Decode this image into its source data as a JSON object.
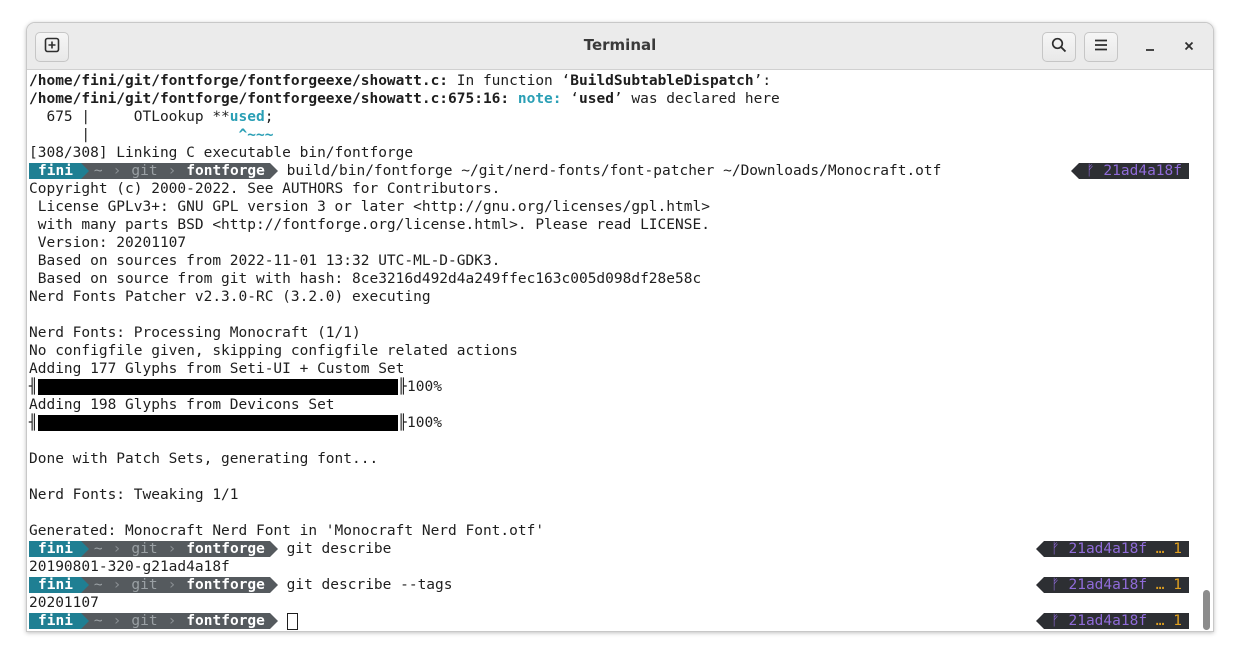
{
  "window": {
    "title": "Terminal"
  },
  "headerbar": {
    "new_tab_icon": "new-tab-icon",
    "search_icon": "search-icon",
    "menu_icon": "hamburger-menu-icon",
    "minimize_glyph": "–",
    "close_glyph": "✕"
  },
  "prompt": {
    "user": "fini",
    "home": "~",
    "dir1": "git",
    "dir2": "fontforge"
  },
  "output": {
    "l1_path": "/home/fini/git/fontforge/fontforgeexe/showatt.c:",
    "l1_text": " In function ",
    "l1_quote_open": "‘",
    "l1_func": "BuildSubtableDispatch",
    "l1_quote_close": "’:",
    "l2_path": "/home/fini/git/fontforge/fontforgeexe/showatt.c:675:16:",
    "l2_note": " note:",
    "l2_text_a": " ‘",
    "l2_used": "used",
    "l2_text_b": "’ was declared here",
    "l3_prefix": "  675 |     OTLookup **",
    "l3_used": "used",
    "l3_suffix": ";",
    "l4_prefix": "      |",
    "l4_caret": "                 ^~~~",
    "l5": "[308/308] Linking C executable bin/fontforge",
    "cmd1": " build/bin/fontforge ~/git/nerd-fonts/font-patcher ~/Downloads/Monocraft.otf",
    "l7": "Copyright (c) 2000-2022. See AUTHORS for Contributors.",
    "l8": " License GPLv3+: GNU GPL version 3 or later <http://gnu.org/licenses/gpl.html>",
    "l9": " with many parts BSD <http://fontforge.org/license.html>. Please read LICENSE.",
    "l10": " Version: 20201107",
    "l11": " Based on sources from 2022-11-01 13:32 UTC-ML-D-GDK3.",
    "l12": " Based on source from git with hash: 8ce3216d492d4a249ffec163c005d098df28e58c",
    "l13": "Nerd Fonts Patcher v2.3.0-RC (3.2.0) executing",
    "l15": "Nerd Fonts: Processing Monocraft (1/1)",
    "l16": "No configfile given, skipping configfile related actions",
    "l17": "Adding 177 Glyphs from Seti-UI + Custom Set",
    "bar1_pct": "100%",
    "bar1_progress": 1.0,
    "l19": "Adding 198 Glyphs from Devicons Set",
    "bar2_pct": "100%",
    "bar2_progress": 1.0,
    "l22": "Done with Patch Sets, generating font...",
    "l24": "Nerd Fonts: Tweaking 1/1",
    "l26": "Generated: Monocraft Nerd Font in 'Monocraft Nerd Font.otf'",
    "cmd2": " git describe",
    "l28": "20190801-320-g21ad4a18f",
    "cmd3": " git describe --tags",
    "l30": "20201107"
  },
  "rprompt": {
    "branch_glyph": "ᚠ",
    "hash": "21ad4a18f",
    "dots": "…",
    "count": "1"
  }
}
